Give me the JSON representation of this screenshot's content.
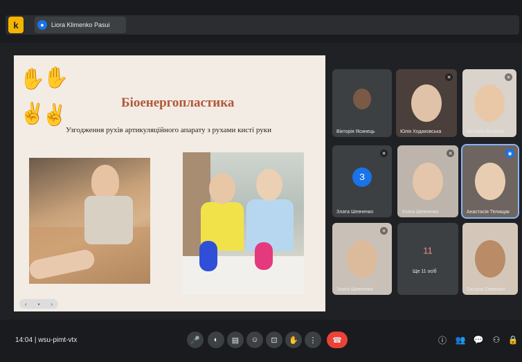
{
  "header": {
    "app_logo": "k",
    "share_chip_text": "Liora Klimenko Pasui",
    "share_icon": "person-icon"
  },
  "slide": {
    "title": "Біоенергопластика",
    "subtitle": "Узгодження рухів артикуляційного апарату з рухами кисті руки",
    "nav": [
      "‹",
      "▪",
      "›"
    ]
  },
  "participants": [
    {
      "name": "Вікторія Ясинець",
      "initial": ""
    },
    {
      "name": "Юлія Ходаковська",
      "initial": ""
    },
    {
      "name": "Вікторія Бєляєва",
      "initial": ""
    },
    {
      "name": "Злата Шевченко",
      "initial": "З"
    },
    {
      "name": "Злата Шевченко",
      "initial": ""
    },
    {
      "name": "Анастасія Телищак",
      "initial": ""
    },
    {
      "name": "Злата Шевченко",
      "initial": ""
    },
    {
      "name": "Ще 11 осіб",
      "initial": "11"
    },
    {
      "name": "Оксана Семенюк",
      "initial": ""
    }
  ],
  "bottombar": {
    "time": "14:04",
    "meeting_code": "wsu-pimt-vtx",
    "controls": [
      "🎤",
      "◐",
      "▤",
      "☺",
      "⊡",
      "✋",
      "⋮",
      "☎"
    ],
    "right_tools": [
      "ⓘ",
      "👥",
      "💬",
      "⚇",
      "🔒"
    ]
  },
  "colors": {
    "background": "#1f2124",
    "tile": "#3c4043",
    "end_call": "#ea4335",
    "slide_title": "#b1563a",
    "accent": "#1a73e8"
  }
}
